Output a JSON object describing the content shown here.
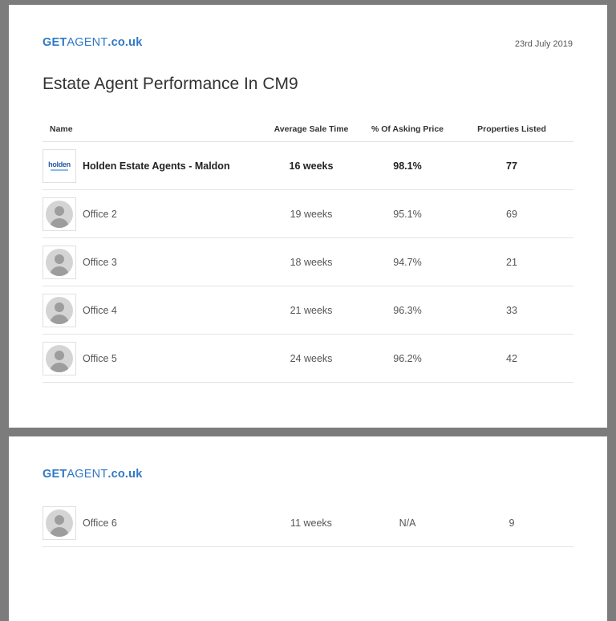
{
  "logo": {
    "get": "GET",
    "agent": "AGENT",
    "domain": ".co.uk"
  },
  "date": "23rd July 2019",
  "title": "Estate Agent Performance In CM9",
  "table": {
    "headers": {
      "name": "Name",
      "time": "Average Sale Time",
      "pct": "% Of Asking Price",
      "listed": "Properties Listed"
    },
    "rows": [
      {
        "name": "Holden Estate Agents - Maldon",
        "time": "16 weeks",
        "pct": "98.1%",
        "listed": "77",
        "logo_text": "holden"
      },
      {
        "name": "Office 2",
        "time": "19 weeks",
        "pct": "95.1%",
        "listed": "69"
      },
      {
        "name": "Office 3",
        "time": "18 weeks",
        "pct": "94.7%",
        "listed": "21"
      },
      {
        "name": "Office 4",
        "time": "21 weeks",
        "pct": "96.3%",
        "listed": "33"
      },
      {
        "name": "Office 5",
        "time": "24 weeks",
        "pct": "96.2%",
        "listed": "42"
      }
    ]
  },
  "page2": {
    "rows": [
      {
        "name": "Office 6",
        "time": "11 weeks",
        "pct": "N/A",
        "listed": "9"
      }
    ]
  },
  "colors": {
    "brand": "#2f78c4",
    "background": "#7c7c7c"
  }
}
